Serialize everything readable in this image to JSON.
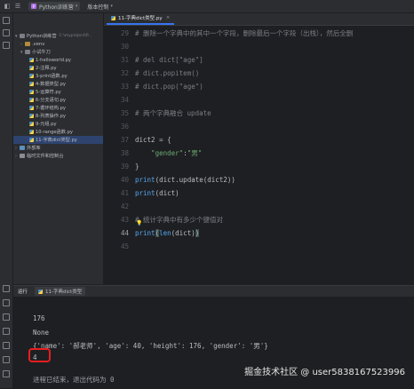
{
  "topbar": {
    "project_name": "Python训练营",
    "vcs_label": "版本控制"
  },
  "project_panel": {
    "tree": [
      {
        "label": "Python训练营",
        "extra": "C:\\myproject\\P..."
      },
      {
        "label": ".venv"
      },
      {
        "label": "小试牛刀"
      },
      {
        "label": "1-helloworld.py"
      },
      {
        "label": "2-注释.py"
      },
      {
        "label": "3-print函数.py"
      },
      {
        "label": "4-数据类型.py"
      },
      {
        "label": "5-运算符.py"
      },
      {
        "label": "6-分支语句.py"
      },
      {
        "label": "7-循环结构.py"
      },
      {
        "label": "8-列表操作.py"
      },
      {
        "label": "9-元组.py"
      },
      {
        "label": "10-range函数.py"
      },
      {
        "label": "11-字典dict类型.py"
      },
      {
        "label": "外部库"
      },
      {
        "label": "临时文件和控制台"
      }
    ]
  },
  "editor": {
    "tab_label": "11-字典dict类型.py",
    "line_numbers": [
      "29",
      "30",
      "31",
      "32",
      "33",
      "34",
      "35",
      "36",
      "37",
      "38",
      "39",
      "40",
      "41",
      "42",
      "43",
      "44",
      "45"
    ],
    "current_line": "44",
    "lines": {
      "l29": "# 删除一个字典中的其中一个字段，删除最后一个字段（出栈），然后全删",
      "l31": "# del dict[\"age\"]",
      "l32": "# dict.popitem()",
      "l33": "# dict.pop(\"age\")",
      "l35": "# 两个字典融合 update",
      "l37": "dict2 = {",
      "l38a": "    \"gender\"",
      "l38b": ":",
      "l38c": "\"男\"",
      "l39": "}",
      "l40a": "print",
      "l40b": "(dict.update(dict2))",
      "l41a": "print",
      "l41b": "(dict)",
      "l42": "# 统计字典中有多少个键值对",
      "l44a": "print",
      "l44b": "(",
      "l44c": "len",
      "l44d": "(dict)",
      "l44e": ")"
    }
  },
  "run": {
    "label": "运行",
    "tab_label": "11-字典dict类型",
    "output": [
      "176",
      "None",
      "{'name': '郝老师', 'age': 40, 'height': 176, 'gender': '男'}",
      "4",
      "",
      "进程已结束，退出代码为 0"
    ]
  },
  "watermark": "掘金技术社区 @ user5838167523996",
  "colors": {
    "highlight_box": "#e81f1f",
    "accent": "#3574f0"
  }
}
